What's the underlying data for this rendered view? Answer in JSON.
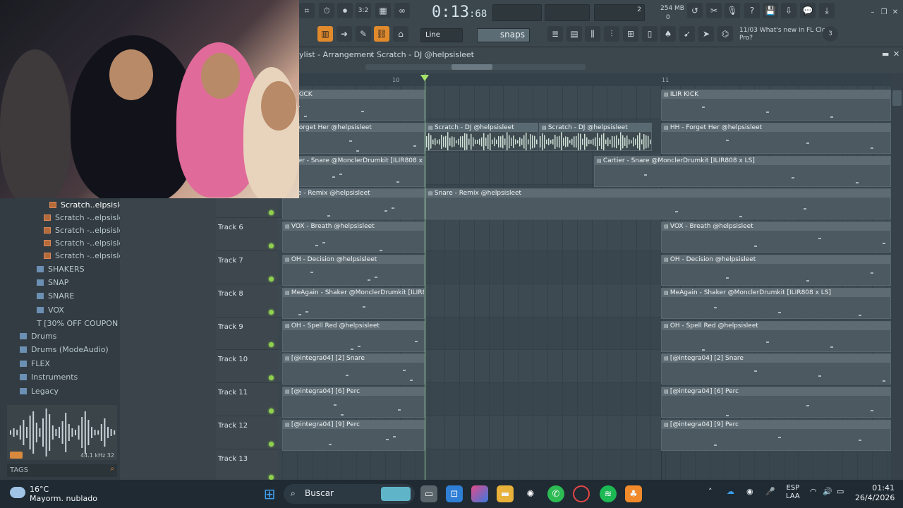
{
  "toolbar": {
    "time_main": "0:13",
    "time_sub": "68",
    "time_label": "M:S:CS",
    "mem_top": "254 MB",
    "mem_bottom": "0",
    "cpu": "2",
    "snap_mode": "Line",
    "snap_label": "snaps",
    "news_date": "11/03",
    "news_text": "What's new in FL Cloud Pro?",
    "news_count": "3"
  },
  "playlist": {
    "title_part1": "ylist - Arrangement",
    "title_sep": "›",
    "title_part2": "Scratch - DJ @helpsisleet",
    "ruler_10": "10",
    "ruler_11": "11"
  },
  "browser": {
    "items": [
      {
        "label": "Scratch..elpsisleet",
        "type": "audio",
        "selected": true
      },
      {
        "label": "Scratch -..elpsisleet",
        "type": "audio"
      },
      {
        "label": "Scratch -..elpsisleet",
        "type": "audio"
      },
      {
        "label": "Scratch -..elpsisleet",
        "type": "audio"
      },
      {
        "label": "Scratch -..elpsisleet",
        "type": "audio"
      },
      {
        "label": "SHAKERS",
        "type": "folder"
      },
      {
        "label": "SNAP",
        "type": "folder"
      },
      {
        "label": "SNARE",
        "type": "folder"
      },
      {
        "label": "VOX",
        "type": "folder"
      },
      {
        "label": "[30% OFF COUPON",
        "type": "text"
      },
      {
        "label": "Drums",
        "type": "folder"
      },
      {
        "label": "Drums (ModeAudio)",
        "type": "folder"
      },
      {
        "label": "FLEX",
        "type": "folder"
      },
      {
        "label": "Instruments",
        "type": "folder"
      },
      {
        "label": "Legacy",
        "type": "folder"
      }
    ],
    "preview_info": "44.1 kHz 32",
    "tags_label": "TAGS"
  },
  "tracks": [
    {
      "name": "",
      "led": false
    },
    {
      "name": "",
      "led": false
    },
    {
      "name": "",
      "led": false
    },
    {
      "name": "",
      "led": true
    },
    {
      "name": "Track 6",
      "led": true
    },
    {
      "name": "Track 7",
      "led": true
    },
    {
      "name": "Track 8",
      "led": true
    },
    {
      "name": "Track 9",
      "led": true
    },
    {
      "name": "Track 10",
      "led": true
    },
    {
      "name": "Track 11",
      "led": true
    },
    {
      "name": "Track 12",
      "led": true
    },
    {
      "name": "Track 13",
      "led": true
    }
  ],
  "clips": [
    {
      "lane": 0,
      "seg": "left",
      "label": "R KICK"
    },
    {
      "lane": 0,
      "seg": "right",
      "label": "ILIR KICK"
    },
    {
      "lane": 1,
      "seg": "left",
      "label": "- Forget Her @helpsisleet"
    },
    {
      "lane": 1,
      "seg": "audio1",
      "label": "Scratch - DJ @helpsisleet"
    },
    {
      "lane": 1,
      "seg": "audio2",
      "label": "Scratch - DJ @helpsisleet"
    },
    {
      "lane": 1,
      "seg": "right",
      "label": "HH - Forget Her @helpsisleet"
    },
    {
      "lane": 2,
      "seg": "left",
      "label": "rtier - Snare @MonclerDrumkit [ILIR808 x LS]"
    },
    {
      "lane": 2,
      "seg": "mid",
      "label": "Cartier - Snare @MonclerDrumkit [ILIR808 x LS]"
    },
    {
      "lane": 3,
      "seg": "left",
      "label": "are - Remix @helpsisleet"
    },
    {
      "lane": 3,
      "seg": "long",
      "label": "Snare - Remix @helpsisleet"
    },
    {
      "lane": 4,
      "seg": "left",
      "label": "VOX - Breath @helpsisleet"
    },
    {
      "lane": 4,
      "seg": "right",
      "label": "VOX - Breath @helpsisleet"
    },
    {
      "lane": 5,
      "seg": "left",
      "label": "OH - Decision @helpsisleet"
    },
    {
      "lane": 5,
      "seg": "right",
      "label": "OH - Decision @helpsisleet"
    },
    {
      "lane": 6,
      "seg": "left",
      "label": "MeAgain - Shaker @MonclerDrumkit [ILIR808 x LS]"
    },
    {
      "lane": 6,
      "seg": "right",
      "label": "MeAgain - Shaker @MonclerDrumkit [ILIR808 x LS]"
    },
    {
      "lane": 7,
      "seg": "left",
      "label": "OH - Spell Red @helpsisleet"
    },
    {
      "lane": 7,
      "seg": "right",
      "label": "OH - Spell Red @helpsisleet"
    },
    {
      "lane": 8,
      "seg": "left",
      "label": "[@integra04] [2] Snare"
    },
    {
      "lane": 8,
      "seg": "right",
      "label": "[@integra04] [2] Snare"
    },
    {
      "lane": 9,
      "seg": "left",
      "label": "[@integra04] [6] Perc"
    },
    {
      "lane": 9,
      "seg": "right",
      "label": "[@integra04] [6] Perc"
    },
    {
      "lane": 10,
      "seg": "left",
      "label": "[@integra04] [9] Perc"
    },
    {
      "lane": 10,
      "seg": "right",
      "label": "[@integra04] [9] Perc"
    }
  ],
  "taskbar": {
    "temp": "16°C",
    "weather": "Mayorm. nublado",
    "search": "Buscar",
    "lang1": "ESP",
    "lang2": "LAA",
    "time": "01:41",
    "date": "26/4/2026"
  }
}
